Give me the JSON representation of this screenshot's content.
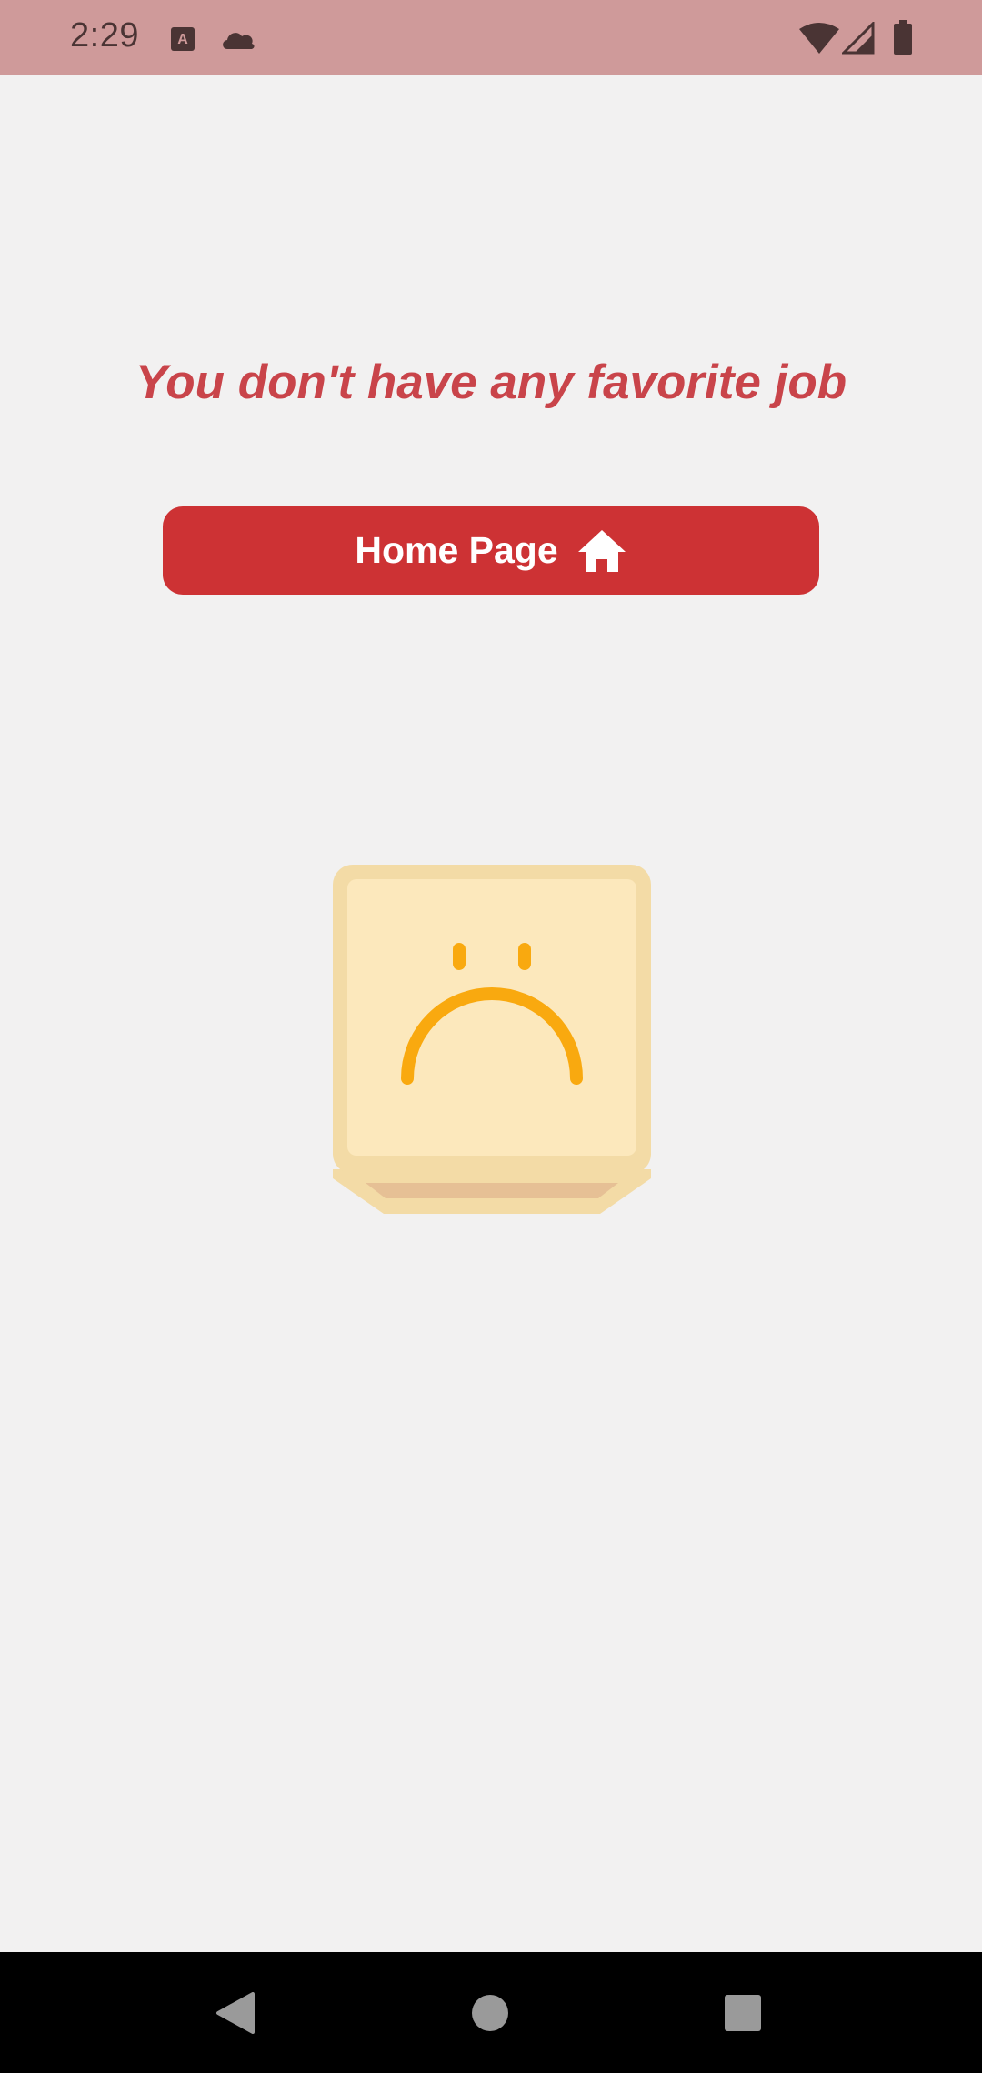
{
  "status_bar": {
    "time": "2:29",
    "icons": [
      "app-a-icon",
      "cloud-icon",
      "wifi-icon",
      "cell-signal-icon",
      "battery-icon"
    ],
    "background_color": "#cf9a9a"
  },
  "main": {
    "empty_message": "You don't have any favorite job",
    "home_button": {
      "label": "Home Page",
      "icon": "home-icon",
      "color": "#cd3234"
    },
    "illustration": "sad-face-box-illustration"
  },
  "nav_bar": {
    "buttons": [
      "back",
      "home",
      "recents"
    ]
  },
  "colors": {
    "accent": "#cd3234",
    "message_text": "#c9444a",
    "background": "#f2f1f1"
  }
}
